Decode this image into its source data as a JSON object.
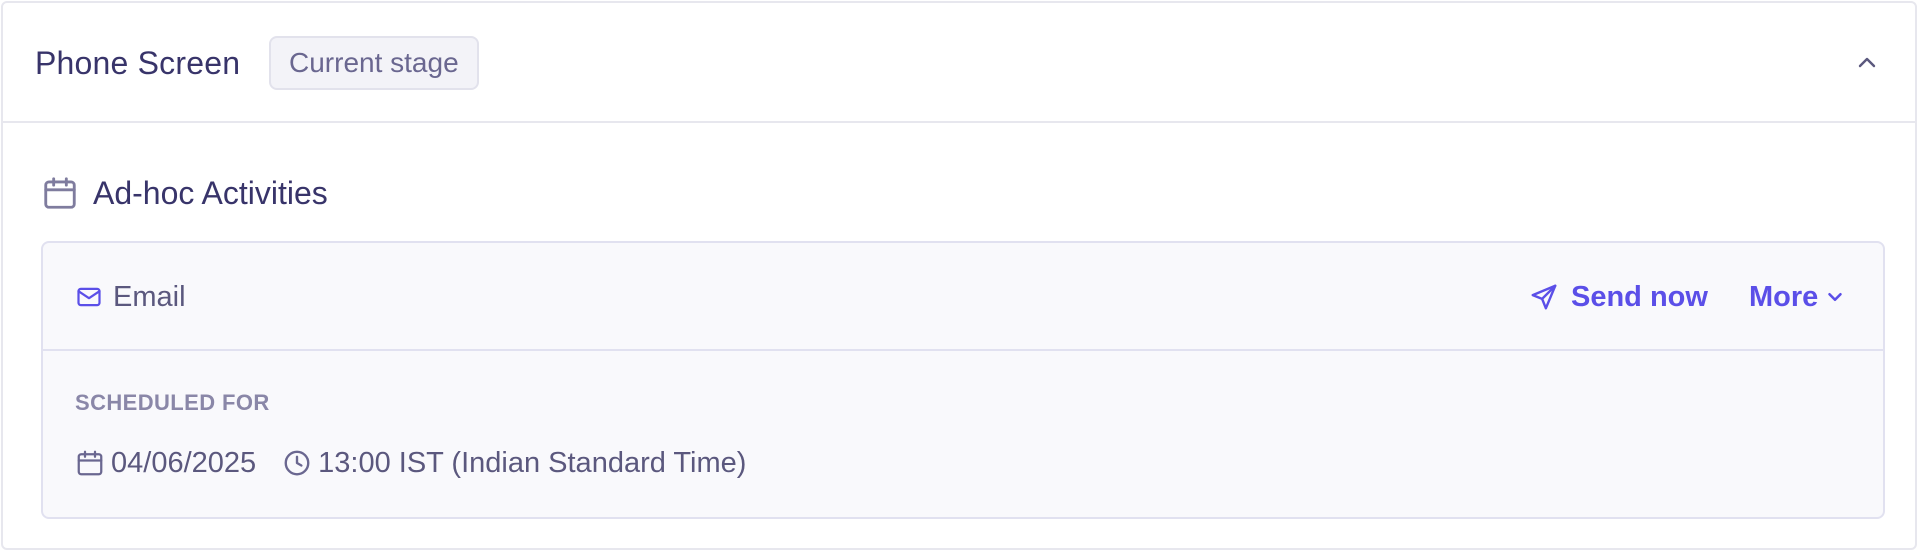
{
  "stage": {
    "title": "Phone Screen",
    "badge": "Current stage"
  },
  "section": {
    "title": "Ad-hoc Activities",
    "icon": "calendar-icon"
  },
  "activity": {
    "type_label": "Email",
    "type_icon": "mail-icon",
    "send_now_label": "Send now",
    "more_label": "More",
    "scheduled_label": "SCHEDULED FOR",
    "date": "04/06/2025",
    "time": "13:00 IST (Indian Standard Time)"
  },
  "colors": {
    "accent": "#5b4fe8",
    "text_primary": "#38346a",
    "text_secondary": "#5b587e",
    "muted": "#8a87a8",
    "border": "#e7e7ee",
    "panel_bg": "#f9f9fc"
  }
}
